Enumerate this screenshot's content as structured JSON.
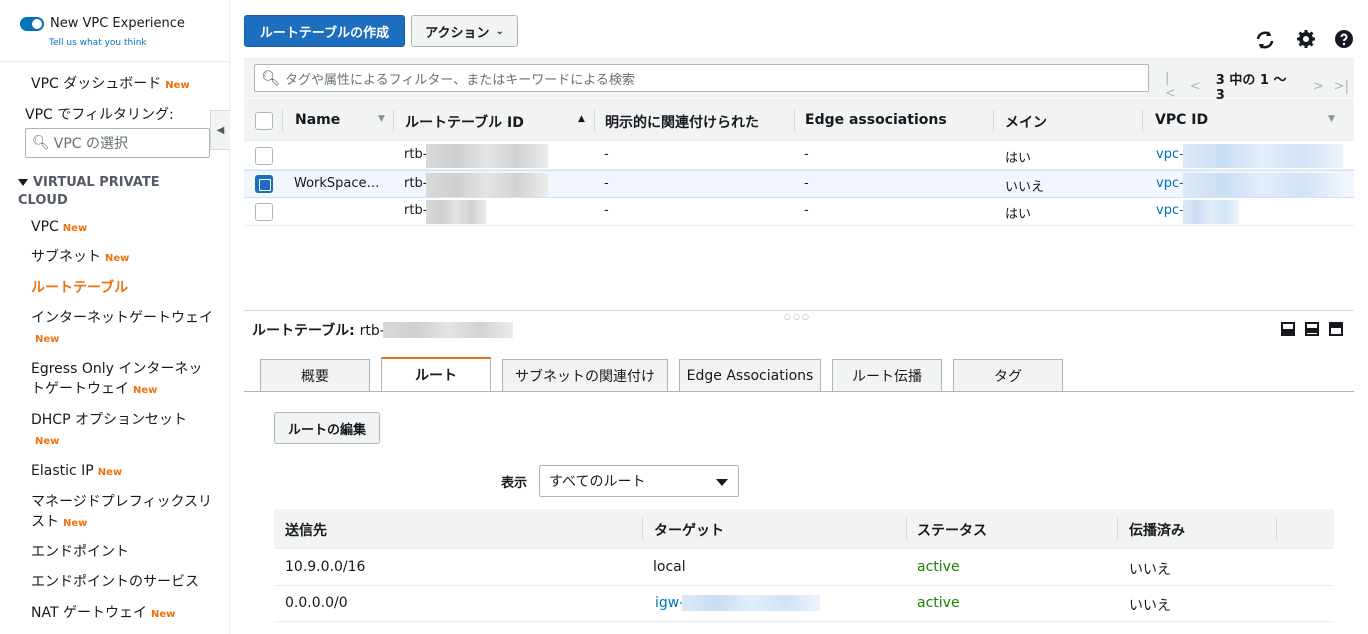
{
  "sidebar": {
    "toggle_label": "New VPC Experience",
    "feedback": "Tell us what you think",
    "dashboard": "VPC ダッシュボード",
    "new_badge": "New",
    "filter_label": "VPC でフィルタリング:",
    "vpc_select_placeholder": "VPC の選択",
    "section_title": "VIRTUAL PRIVATE CLOUD",
    "items": [
      {
        "label": "VPC",
        "new": "New"
      },
      {
        "label": "サブネット",
        "new": "New"
      },
      {
        "label": "ルートテーブル",
        "new": ""
      },
      {
        "label": "インターネットゲートウェイ",
        "new": "New"
      },
      {
        "label": "Egress Only インターネットゲートウェイ",
        "new": "New"
      },
      {
        "label": "DHCP オプションセット",
        "new": "New"
      },
      {
        "label": "Elastic IP",
        "new": "New"
      },
      {
        "label": "マネージドプレフィックスリスト",
        "new": "New"
      },
      {
        "label": "エンドポイント",
        "new": ""
      },
      {
        "label": "エンドポイントのサービス",
        "new": ""
      },
      {
        "label": "NAT ゲートウェイ",
        "new": "New"
      }
    ]
  },
  "toolbar": {
    "create_label": "ルートテーブルの作成",
    "action_label": "アクション"
  },
  "search": {
    "placeholder": "タグや属性によるフィルター、またはキーワードによる検索"
  },
  "pager": {
    "text": "3 中の 1 〜 3"
  },
  "table": {
    "columns": [
      "Name",
      "ルートテーブル ID",
      "明示的に関連付けられた",
      "Edge associations",
      "メイン",
      "VPC ID"
    ],
    "rows": [
      {
        "name": "",
        "id": "rtb-",
        "explicit": "-",
        "edge": "-",
        "main": "はい",
        "vpc": "vpc-",
        "selected": false
      },
      {
        "name": "WorkSpace…",
        "id": "rtb-",
        "explicit": "-",
        "edge": "-",
        "main": "いいえ",
        "vpc": "vpc-",
        "selected": true
      },
      {
        "name": "",
        "id": "rtb-",
        "explicit": "-",
        "edge": "-",
        "main": "はい",
        "vpc": "vpc-",
        "selected": false
      }
    ]
  },
  "detail": {
    "title_label": "ルートテーブル:",
    "title_id": "rtb-",
    "tabs": [
      "概要",
      "ルート",
      "サブネットの関連付け",
      "Edge Associations",
      "ルート伝播",
      "タグ"
    ],
    "edit_routes_label": "ルートの編集",
    "show_label": "表示",
    "show_value": "すべてのルート",
    "routes_columns": [
      "送信先",
      "ターゲット",
      "ステータス",
      "伝播済み"
    ],
    "routes": [
      {
        "destination": "10.9.0.0/16",
        "target": "local",
        "status": "active",
        "propagated": "いいえ"
      },
      {
        "destination": "0.0.0.0/0",
        "target": "igw-",
        "status": "active",
        "propagated": "いいえ"
      }
    ]
  }
}
